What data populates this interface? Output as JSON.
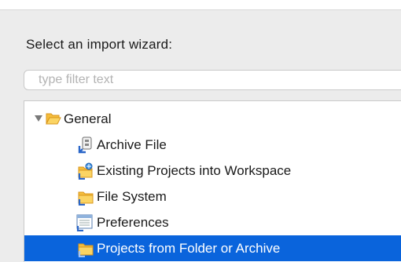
{
  "prompt": "Select an import wizard:",
  "filter": {
    "placeholder": "type filter text",
    "value": ""
  },
  "tree": {
    "group": {
      "label": "General",
      "expanded": true
    },
    "items": [
      {
        "label": "Archive File",
        "icon": "archive-file-icon",
        "selected": false
      },
      {
        "label": "Existing Projects into Workspace",
        "icon": "existing-projects-icon",
        "selected": false
      },
      {
        "label": "File System",
        "icon": "folder-icon",
        "selected": false
      },
      {
        "label": "Preferences",
        "icon": "preferences-icon",
        "selected": false
      },
      {
        "label": "Projects from Folder or Archive",
        "icon": "folder-icon",
        "selected": true
      }
    ]
  },
  "colors": {
    "selection": "#0a64dc",
    "folder": "#f5bd3c",
    "folder_dark": "#d9971d",
    "badge": "#2a66c8"
  }
}
